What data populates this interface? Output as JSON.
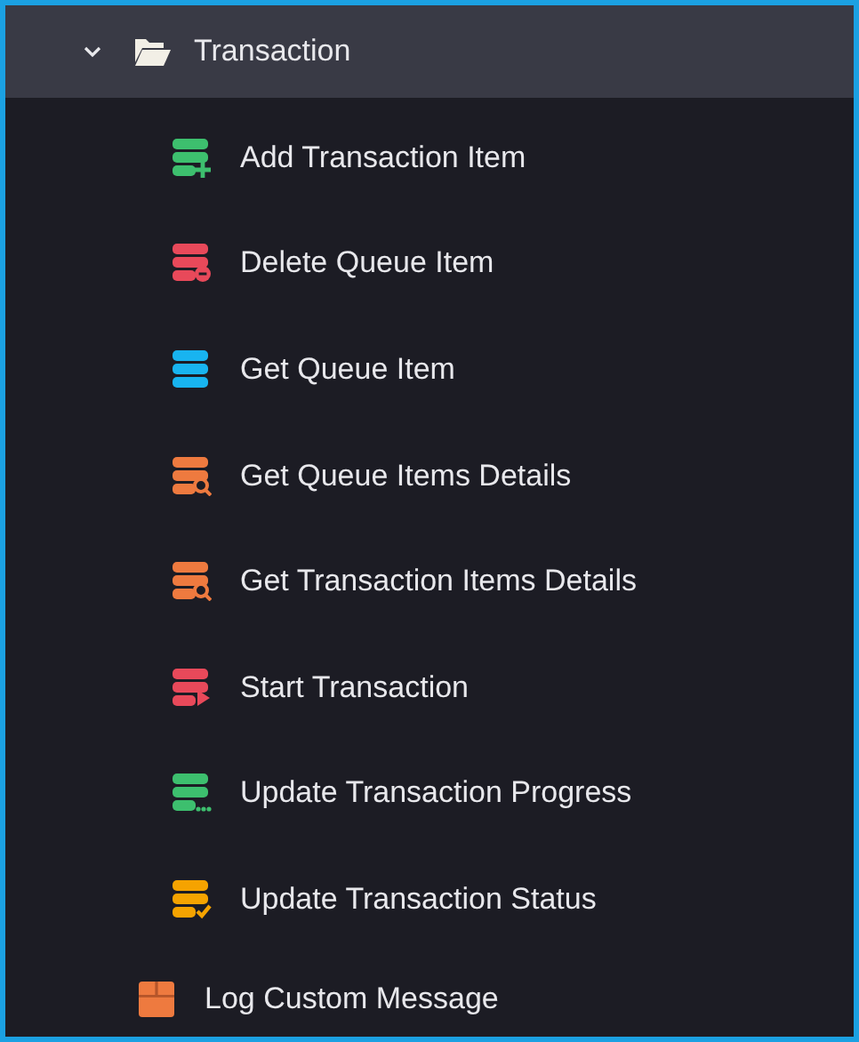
{
  "folder": {
    "label": "Transaction",
    "expanded": true,
    "children": [
      {
        "label": "Add Transaction Item",
        "color": "#3dbf6e",
        "kind": "add"
      },
      {
        "label": "Delete Queue Item",
        "color": "#e8495a",
        "kind": "remove"
      },
      {
        "label": "Get Queue Item",
        "color": "#18b4f0",
        "kind": "plain"
      },
      {
        "label": "Get Queue Items Details",
        "color": "#ee7a3f",
        "kind": "search"
      },
      {
        "label": "Get Transaction Items Details",
        "color": "#ee7a3f",
        "kind": "search"
      },
      {
        "label": "Start Transaction",
        "color": "#e8495a",
        "kind": "play"
      },
      {
        "label": "Update Transaction Progress",
        "color": "#3dbf6e",
        "kind": "progress"
      },
      {
        "label": "Update Transaction Status",
        "color": "#f5a300",
        "kind": "check"
      }
    ]
  },
  "items": [
    {
      "label": "Log Custom Message",
      "color": "#ee7a3f",
      "kind": "box"
    }
  ]
}
